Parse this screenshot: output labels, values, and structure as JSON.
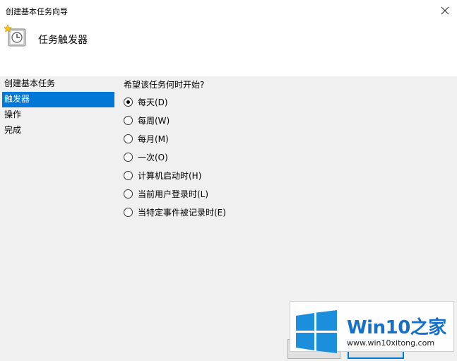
{
  "window": {
    "title": "创建基本任务向导",
    "close_glyph": "✕"
  },
  "header": {
    "title": "任务触发器",
    "icon": "task-clock-icon"
  },
  "sidebar": {
    "items": [
      {
        "label": "创建基本任务",
        "active": false
      },
      {
        "label": "触发器",
        "active": true
      },
      {
        "label": "操作",
        "active": false
      },
      {
        "label": "完成",
        "active": false
      }
    ]
  },
  "content": {
    "question": "希望该任务何时开始?",
    "options": [
      {
        "label": "每天(D)",
        "checked": true
      },
      {
        "label": "每周(W)",
        "checked": false
      },
      {
        "label": "每月(M)",
        "checked": false
      },
      {
        "label": "一次(O)",
        "checked": false
      },
      {
        "label": "计算机启动时(H)",
        "checked": false
      },
      {
        "label": "当前用户登录时(L)",
        "checked": false
      },
      {
        "label": "当特定事件被记录时(E)",
        "checked": false
      }
    ]
  },
  "watermark": {
    "brand_prefix": "Win10",
    "brand_suffix": "之家",
    "url": "www.win10xitong.com"
  },
  "colors": {
    "accent": "#0078d7",
    "window_bg": "#f0f0f0",
    "win_logo": "#1b8fdc"
  }
}
